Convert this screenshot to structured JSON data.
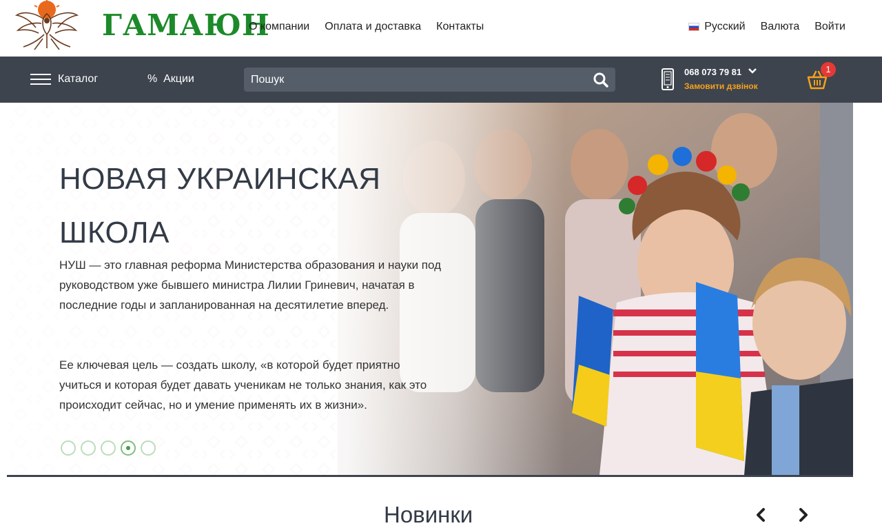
{
  "header": {
    "brand": "ГАМАЮН",
    "nav": [
      "О компании",
      "Оплата и доставка",
      "Контакты"
    ],
    "language": "Русский",
    "currency": "Валюта",
    "login": "Войти"
  },
  "toolbar": {
    "catalog": "Каталог",
    "promo": "%  Акции",
    "search_placeholder": "Пошук",
    "phone": "068 073 79 81",
    "callback": "Замовити дзвінок",
    "cart_count": "1"
  },
  "hero": {
    "title": "НОВАЯ УКРАИНСКАЯ ШКОЛА",
    "paragraph1": "НУШ — это главная реформа Министерства образования и науки под руководством уже бывшего министра Лилии Гриневич, начатая в последние годы и запланированная на десятилетие вперед.",
    "paragraph2": "Ее ключевая цель — создать школу, «в которой будет приятно учиться и которая будет давать ученикам не только знания, как это происходит сейчас, но и умение применять их в жизни».",
    "slides_total": 5,
    "active_slide": 4
  },
  "section": {
    "title": "Новинки"
  },
  "colors": {
    "brand_green": "#1d8a2a",
    "dark_bar": "#3d444e",
    "accent_orange": "#f7a21b",
    "badge_red": "#e53935"
  },
  "icons": [
    "firebird-logo",
    "flag-ru-icon",
    "menu-icon",
    "search-icon",
    "phone-icon",
    "chevron-down-icon",
    "basket-icon",
    "arrow-left-icon",
    "arrow-right-icon"
  ]
}
